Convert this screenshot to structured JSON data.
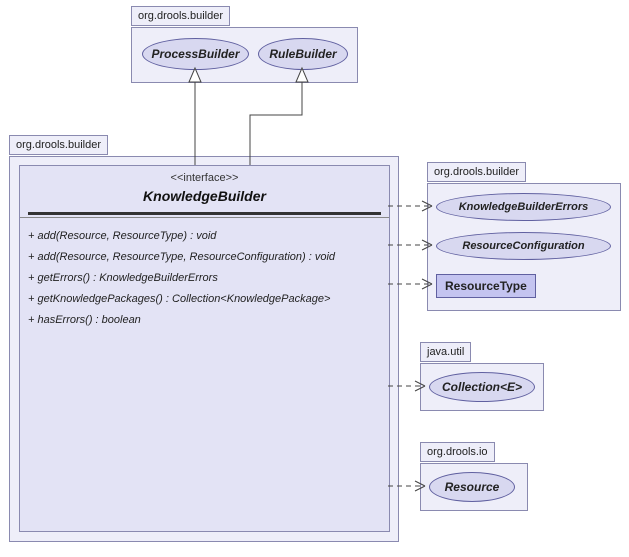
{
  "top_package": {
    "label": "org.drools.builder",
    "process_builder": "ProcessBuilder",
    "rule_builder": "RuleBuilder"
  },
  "main_package": {
    "label": "org.drools.builder",
    "interface_stereo": "<<interface>>",
    "interface_name": "KnowledgeBuilder",
    "operations": [
      "+ add(Resource, ResourceType) : void",
      "+ add(Resource, ResourceType, ResourceConfiguration) : void",
      "+ getErrors() : KnowledgeBuilderErrors",
      "+ getKnowledgePackages() : Collection<KnowledgePackage>",
      "+ hasErrors() : boolean"
    ]
  },
  "right_package_1": {
    "label": "org.drools.builder",
    "knowledge_builder_errors": "KnowledgeBuilderErrors",
    "resource_configuration": "ResourceConfiguration",
    "resource_type": "ResourceType"
  },
  "right_package_2": {
    "label": "java.util",
    "collection": "Collection<E>"
  },
  "right_package_3": {
    "label": "org.drools.io",
    "resource": "Resource"
  }
}
